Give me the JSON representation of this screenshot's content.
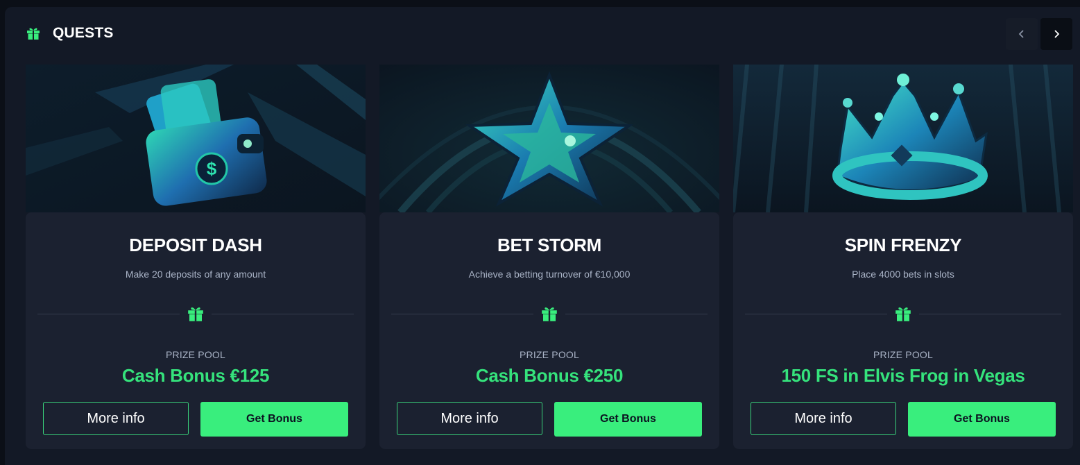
{
  "header": {
    "title": "QUESTS",
    "icon": "gift-icon"
  },
  "nav": {
    "prev_icon": "chevron-left-icon",
    "next_icon": "chevron-right-icon"
  },
  "colors": {
    "accent": "#39ee7d",
    "prize_text": "#35e37c",
    "card_bg": "#1b2130",
    "panel_bg": "#131926"
  },
  "quests": [
    {
      "title": "DEPOSIT DASH",
      "description": "Make 20 deposits of any amount",
      "pool_label": "PRIZE POOL",
      "prize": "Cash Bonus €125",
      "more_label": "More info",
      "get_label": "Get Bonus",
      "art_icon": "wallet-icon"
    },
    {
      "title": "BET STORM",
      "description": "Achieve a betting turnover of €10,000",
      "pool_label": "PRIZE POOL",
      "prize": "Cash Bonus €250",
      "more_label": "More info",
      "get_label": "Get Bonus",
      "art_icon": "star-icon"
    },
    {
      "title": "SPIN FRENZY",
      "description": "Place 4000 bets in slots",
      "pool_label": "PRIZE POOL",
      "prize": "150 FS in Elvis Frog in Vegas",
      "more_label": "More info",
      "get_label": "Get Bonus",
      "art_icon": "crown-icon"
    }
  ]
}
